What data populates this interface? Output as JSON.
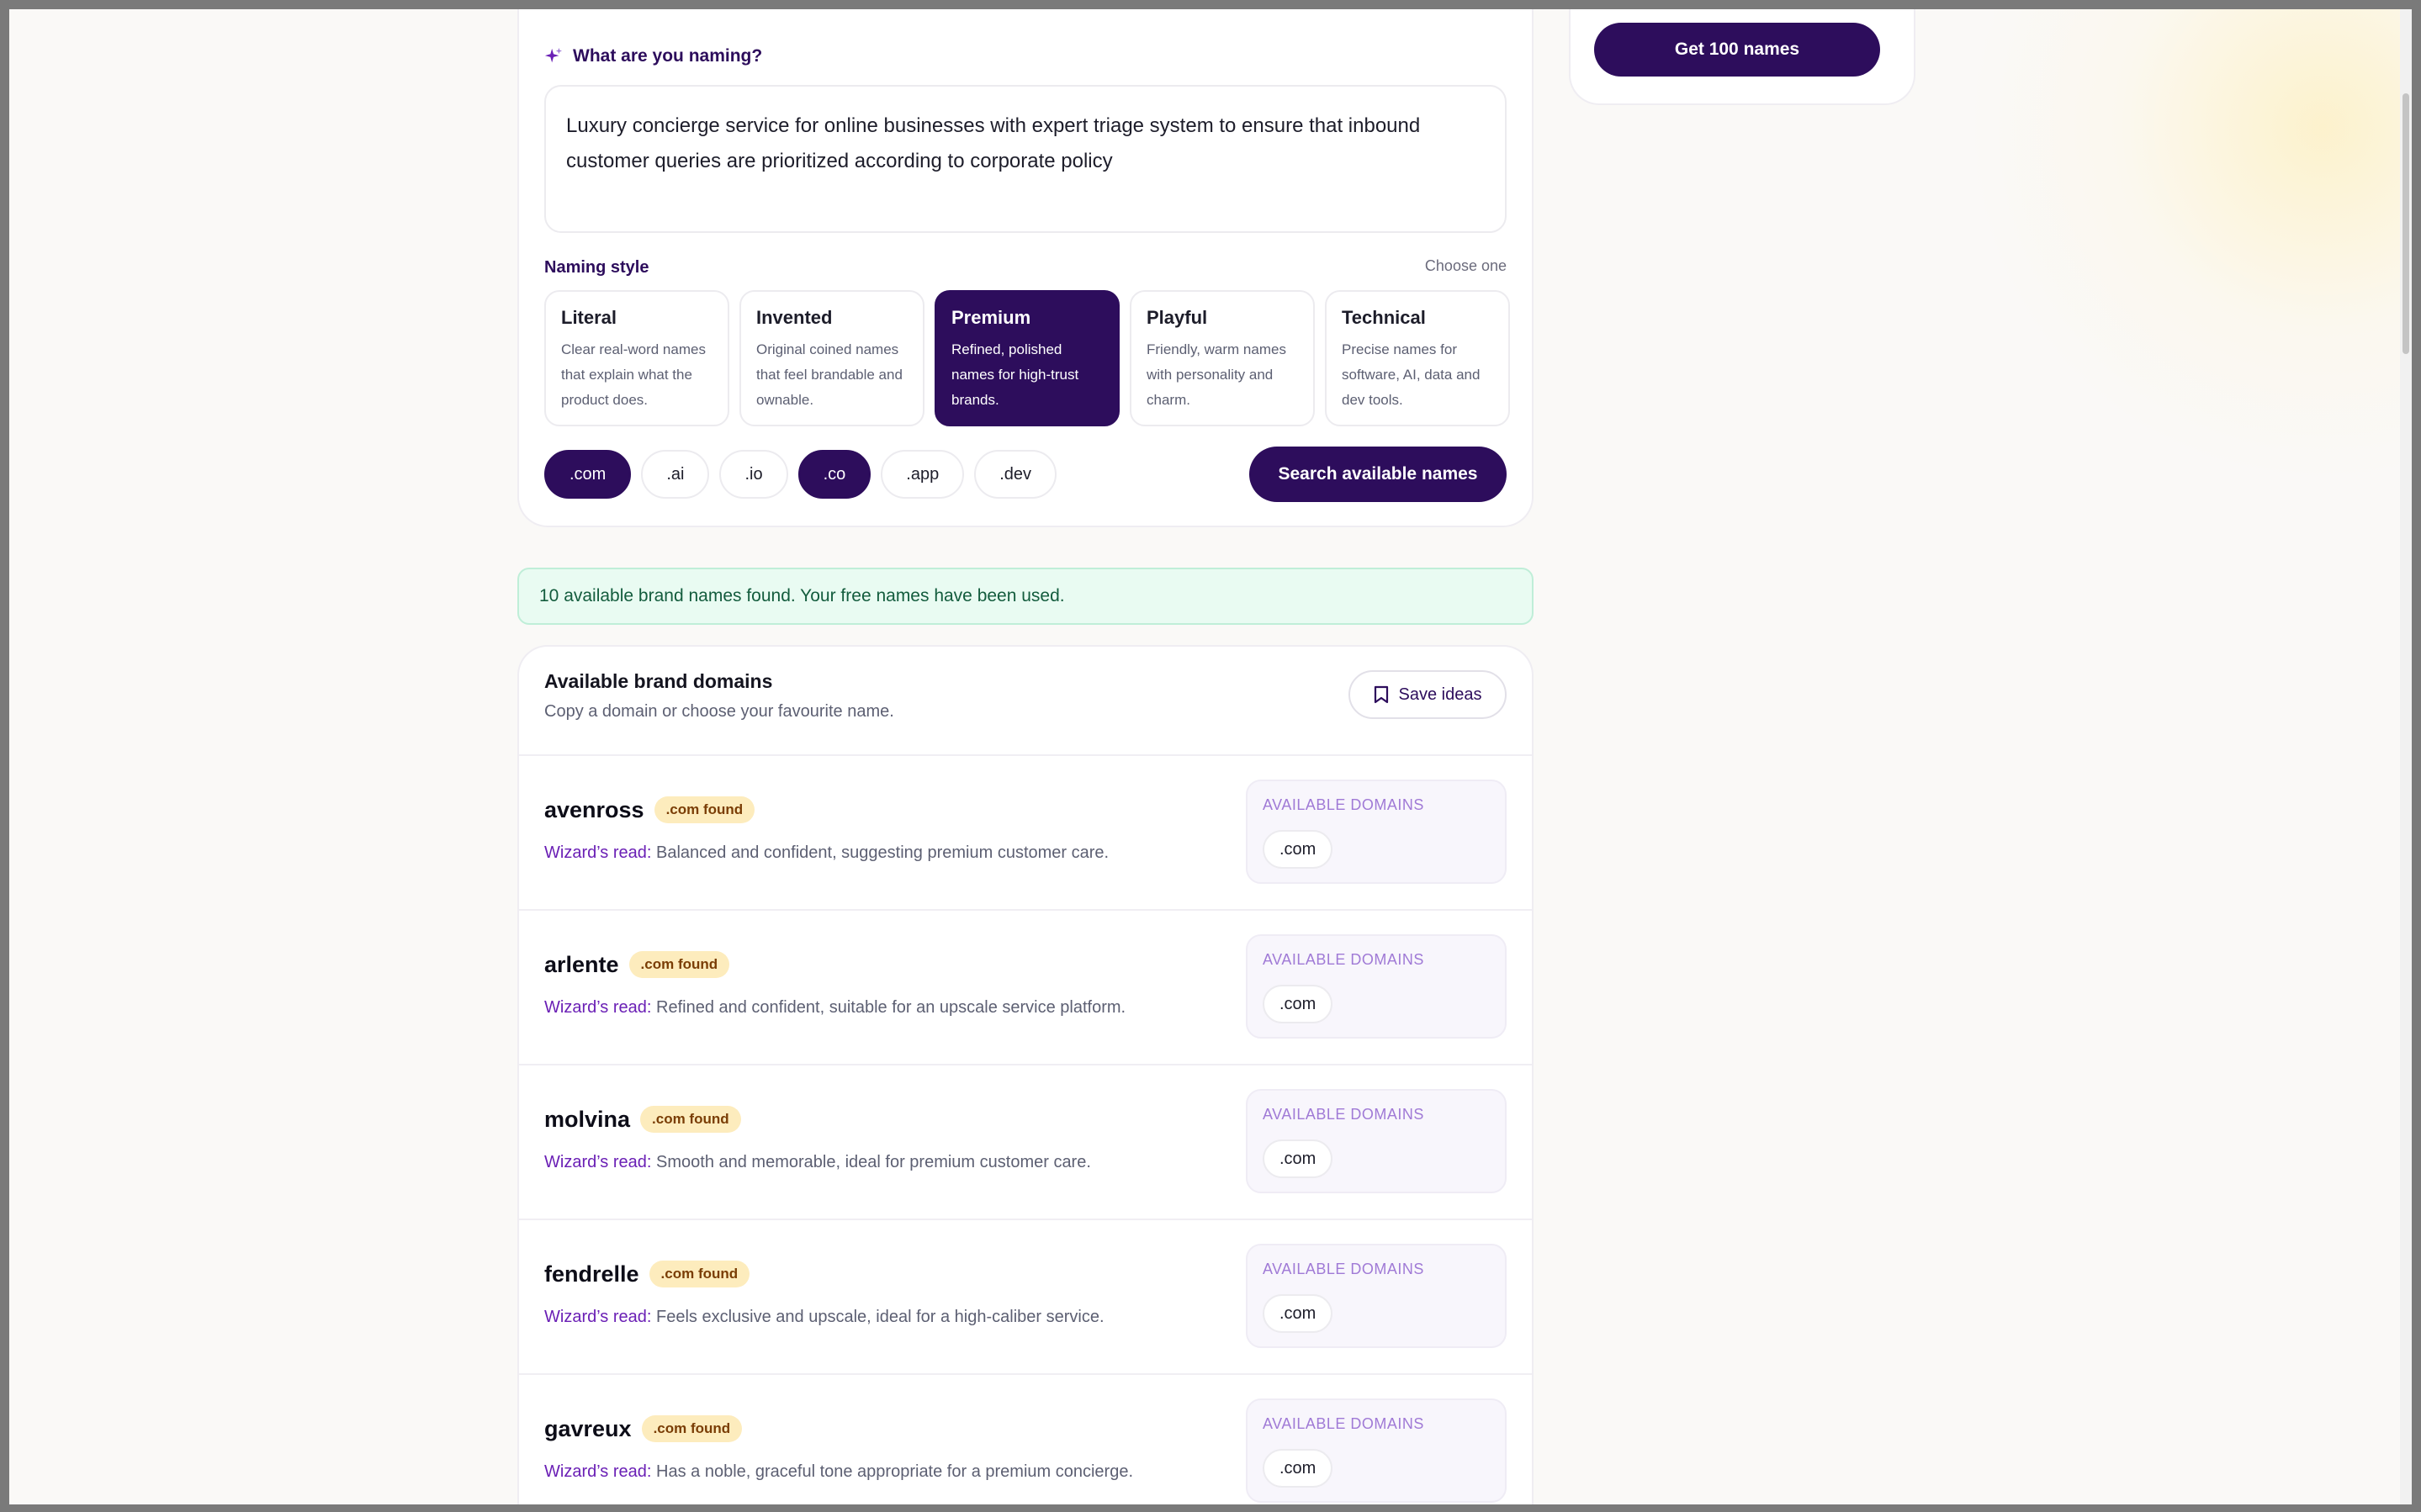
{
  "side": {
    "get_names_label": "Get 100 names"
  },
  "form": {
    "question_label": "What are you naming?",
    "description": "Luxury concierge service for online businesses with expert triage system to ensure that inbound customer queries are prioritized according to corporate policy",
    "naming_style_label": "Naming style",
    "choose_hint": "Choose one",
    "styles": [
      {
        "title": "Literal",
        "desc": "Clear real-word names that explain what the product does.",
        "selected": false
      },
      {
        "title": "Invented",
        "desc": "Original coined names that feel brandable and ownable.",
        "selected": false
      },
      {
        "title": "Premium",
        "desc": "Refined, polished names for high-trust brands.",
        "selected": true
      },
      {
        "title": "Playful",
        "desc": "Friendly, warm names with personality and charm.",
        "selected": false
      },
      {
        "title": "Technical",
        "desc": "Precise names for software, AI, data and dev tools.",
        "selected": false
      }
    ],
    "tlds": [
      {
        "label": ".com",
        "selected": true
      },
      {
        "label": ".ai",
        "selected": false
      },
      {
        "label": ".io",
        "selected": false
      },
      {
        "label": ".co",
        "selected": true
      },
      {
        "label": ".app",
        "selected": false
      },
      {
        "label": ".dev",
        "selected": false
      }
    ],
    "search_label": "Search available names"
  },
  "notice": {
    "text": "10 available brand names found. Your free names have been used."
  },
  "results": {
    "title": "Available brand domains",
    "subtitle": "Copy a domain or choose your favourite name.",
    "save_label": "Save ideas",
    "read_prefix": "Wizard’s read:",
    "avail_label": "AVAILABLE DOMAINS",
    "items": [
      {
        "name": "avenross",
        "badge": ".com found",
        "read": "Balanced and confident, suggesting premium customer care.",
        "domain": ".com"
      },
      {
        "name": "arlente",
        "badge": ".com found",
        "read": "Refined and confident, suitable for an upscale service platform.",
        "domain": ".com"
      },
      {
        "name": "molvina",
        "badge": ".com found",
        "read": "Smooth and memorable, ideal for premium customer care.",
        "domain": ".com"
      },
      {
        "name": "fendrelle",
        "badge": ".com found",
        "read": "Feels exclusive and upscale, ideal for a high-caliber service.",
        "domain": ".com"
      },
      {
        "name": "gavreux",
        "badge": ".com found",
        "read": "Has a noble, graceful tone appropriate for a premium concierge.",
        "domain": ".com"
      }
    ]
  },
  "colors": {
    "brand": "#2d0d5c",
    "accent": "#6a1fb5",
    "badge": "#fdecbd",
    "notice_bg": "#e9fbf2"
  }
}
